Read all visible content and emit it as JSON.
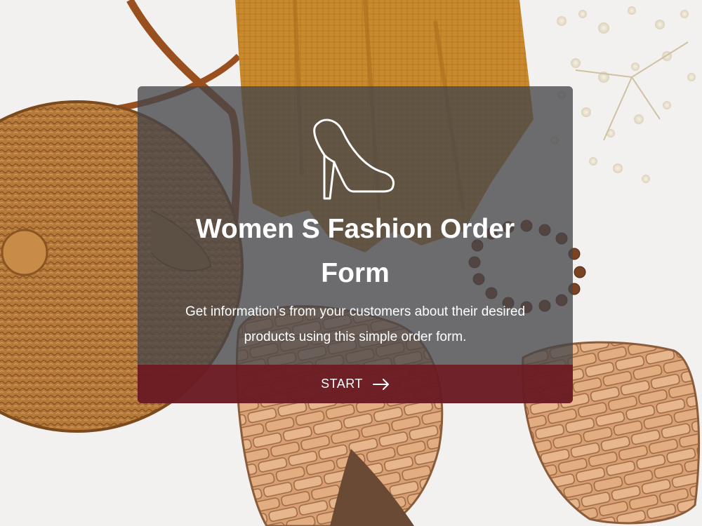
{
  "background": {
    "description_icon": "fashion-accessories-photo"
  },
  "card": {
    "icon": "high-heel-shoe-icon",
    "title": "Women S Fashion Order Form",
    "description": "Get information's from your customers about their desired products using this simple order form.",
    "start_button": {
      "label": "START",
      "icon": "arrow-right-icon"
    }
  },
  "colors": {
    "card_background": "#46464a",
    "button_background": "#70161e",
    "text": "#ffffff"
  }
}
